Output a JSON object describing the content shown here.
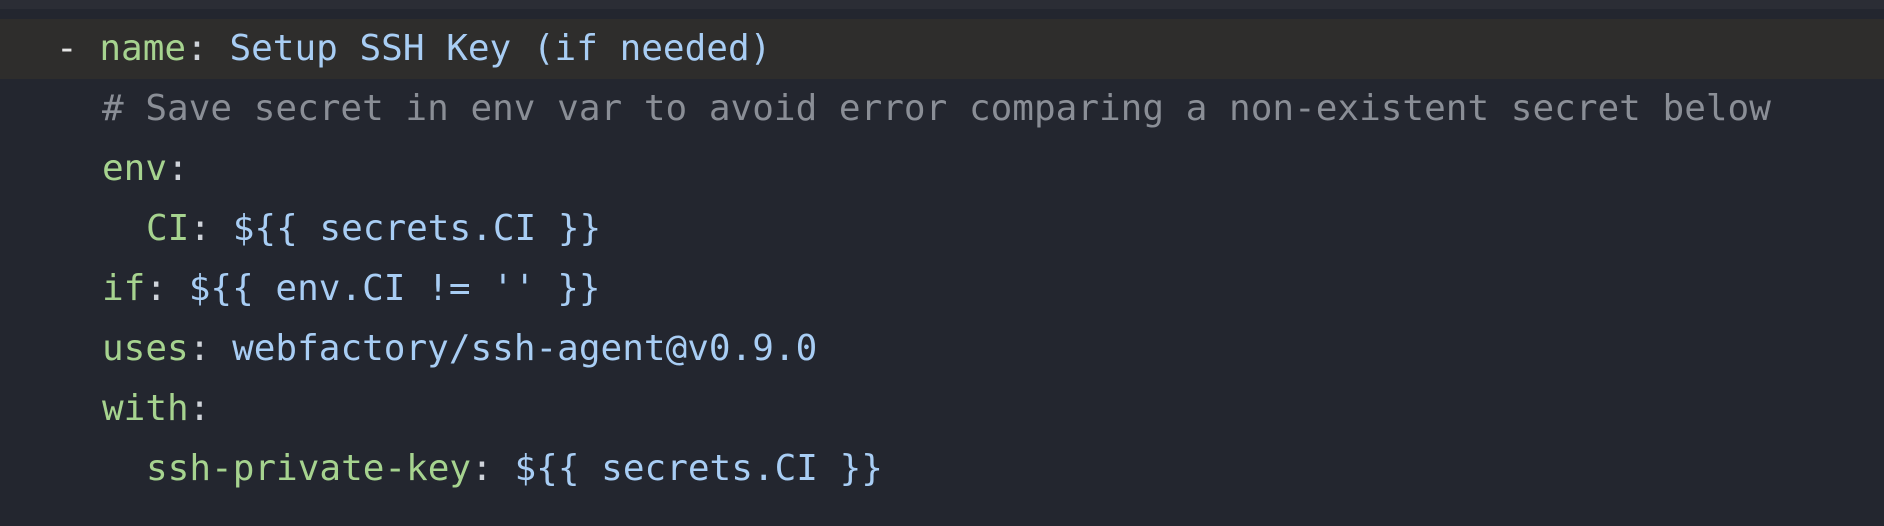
{
  "editor": {
    "colors": {
      "background": "#23262f",
      "current_line": "#2e2d2c",
      "key": "#a6d38f",
      "value": "#a8cdf4",
      "comment": "#8a8e96"
    },
    "lines": {
      "l1": {
        "dash": "-",
        "key": "name",
        "colon": ":",
        "value": "Setup SSH Key (if needed)"
      },
      "l2": {
        "comment": "# Save secret in env var to avoid error comparing a non-existent secret below"
      },
      "l3": {
        "key": "env",
        "colon": ":"
      },
      "l4": {
        "key": "CI",
        "colon": ":",
        "value": "${{ secrets.CI }}"
      },
      "l5": {
        "key": "if",
        "colon": ":",
        "value": "${{ env.CI != '' }}"
      },
      "l6": {
        "key": "uses",
        "colon": ":",
        "value": "webfactory/ssh-agent@v0.9.0"
      },
      "l7": {
        "key": "with",
        "colon": ":"
      },
      "l8": {
        "key": "ssh-private-key",
        "colon": ":",
        "value": "${{ secrets.CI }}"
      }
    }
  }
}
